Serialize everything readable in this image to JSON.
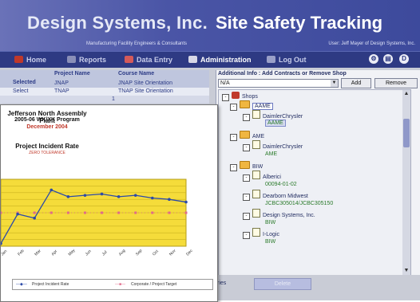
{
  "app": {
    "brand": "Design Systems, Inc.",
    "title": "Site Safety Tracking",
    "subtitle": "Manufacturing Facility Engineers & Consultants",
    "user": "User: Jeff Mayer of Design Systems, Inc."
  },
  "nav": {
    "tabs": [
      "Home",
      "Reports",
      "Data Entry",
      "Administration",
      "Log Out"
    ]
  },
  "courses": {
    "headers": [
      "Selected",
      "Project Name",
      "Course Name"
    ],
    "rows": [
      {
        "sel": "Selected",
        "project": "JNAP",
        "course": "JNAP Site Orientation"
      },
      {
        "sel": "Select",
        "project": "TNAP",
        "course": "TNAP Site Orientation"
      }
    ],
    "page": "1"
  },
  "panel": {
    "label": "Additional Info : Add Contracts or Remove Shop",
    "combo_value": "N/A",
    "add_label": "Add",
    "remove_label": "Remove"
  },
  "tree": {
    "root": "Shops",
    "nodes": [
      {
        "name": "AAME",
        "children": [
          {
            "name": "DaimlerChrysler",
            "leaf": "AAME"
          }
        ]
      },
      {
        "name": "AME",
        "children": [
          {
            "name": "DaimlerChrysler",
            "leaf": "AME"
          }
        ]
      },
      {
        "name": "BIW",
        "children": [
          {
            "name": "Alberici",
            "leaf": "00094-01-02"
          },
          {
            "name": "Dearborn Midwest",
            "leaf": "JCBC305014/JCBC305150"
          },
          {
            "name": "Design Systems, Inc.",
            "leaf": "BIW"
          },
          {
            "name": "I-Logic",
            "leaf": "BIW"
          }
        ]
      }
    ]
  },
  "bottom": {
    "btn1": "ries",
    "btn2": "Delete"
  },
  "report": {
    "plant": "Jefferson North Assembly Plant",
    "program": "2005-06 WK/XK Program",
    "date": "December 2004",
    "chart_title": "Project Incident Rate",
    "tagline": "ZERO TOLERANCE",
    "legend_rate": "Project Incident Rate",
    "legend_target": "Corporate / Project Target"
  },
  "chart_data": {
    "type": "line",
    "categories": [
      "Jan",
      "Feb",
      "Mar",
      "Apr",
      "May",
      "Jun",
      "Jul",
      "Aug",
      "Sep",
      "Oct",
      "Nov",
      "Dec"
    ],
    "series": [
      {
        "name": "Project Incident Rate",
        "values": [
          0.2,
          2.4,
          2.1,
          4.2,
          3.7,
          3.8,
          3.9,
          3.7,
          3.8,
          3.6,
          3.5,
          3.3
        ]
      },
      {
        "name": "Corporate / Project Target",
        "values": [
          2.5,
          2.5,
          2.5,
          2.5,
          2.5,
          2.5,
          2.5,
          2.5,
          2.5,
          2.5,
          2.5,
          2.5
        ]
      }
    ],
    "ylim": [
      0,
      5
    ],
    "grid": true
  }
}
